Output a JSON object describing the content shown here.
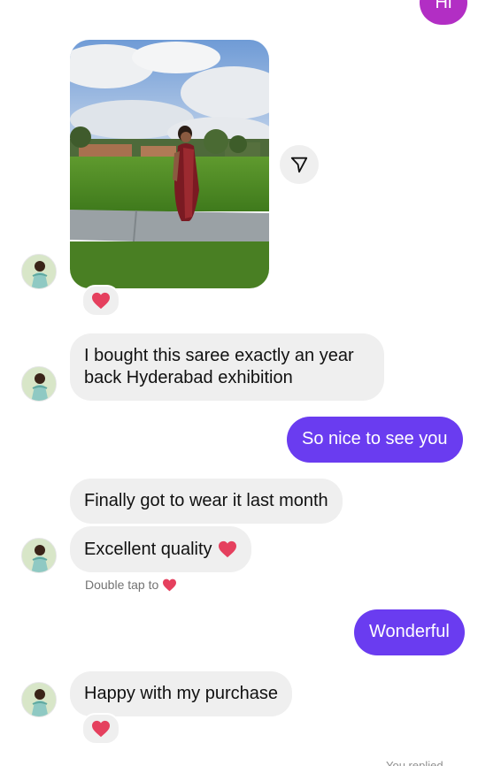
{
  "messages": {
    "hi": "Hi",
    "saree": "I bought this saree exactly an year back Hyderabad exhibition",
    "nice": "So nice to see you",
    "finally": "Finally got to wear it last month",
    "quality": "Excellent quality",
    "wonderful": "Wonderful",
    "happy": "Happy with my purchase"
  },
  "hint": {
    "double_tap": "Double tap to"
  },
  "photo": {
    "alt": "Woman in a maroon saree standing on grass in a park"
  },
  "footer": {
    "partial": "You replied"
  },
  "icons": {
    "heart": "heart-icon",
    "share": "share-icon"
  },
  "colors": {
    "outgoing": "#6a3cf0",
    "outgoing_top": "#b22ec4",
    "incoming": "#efefef",
    "heart": "#e5405e"
  }
}
